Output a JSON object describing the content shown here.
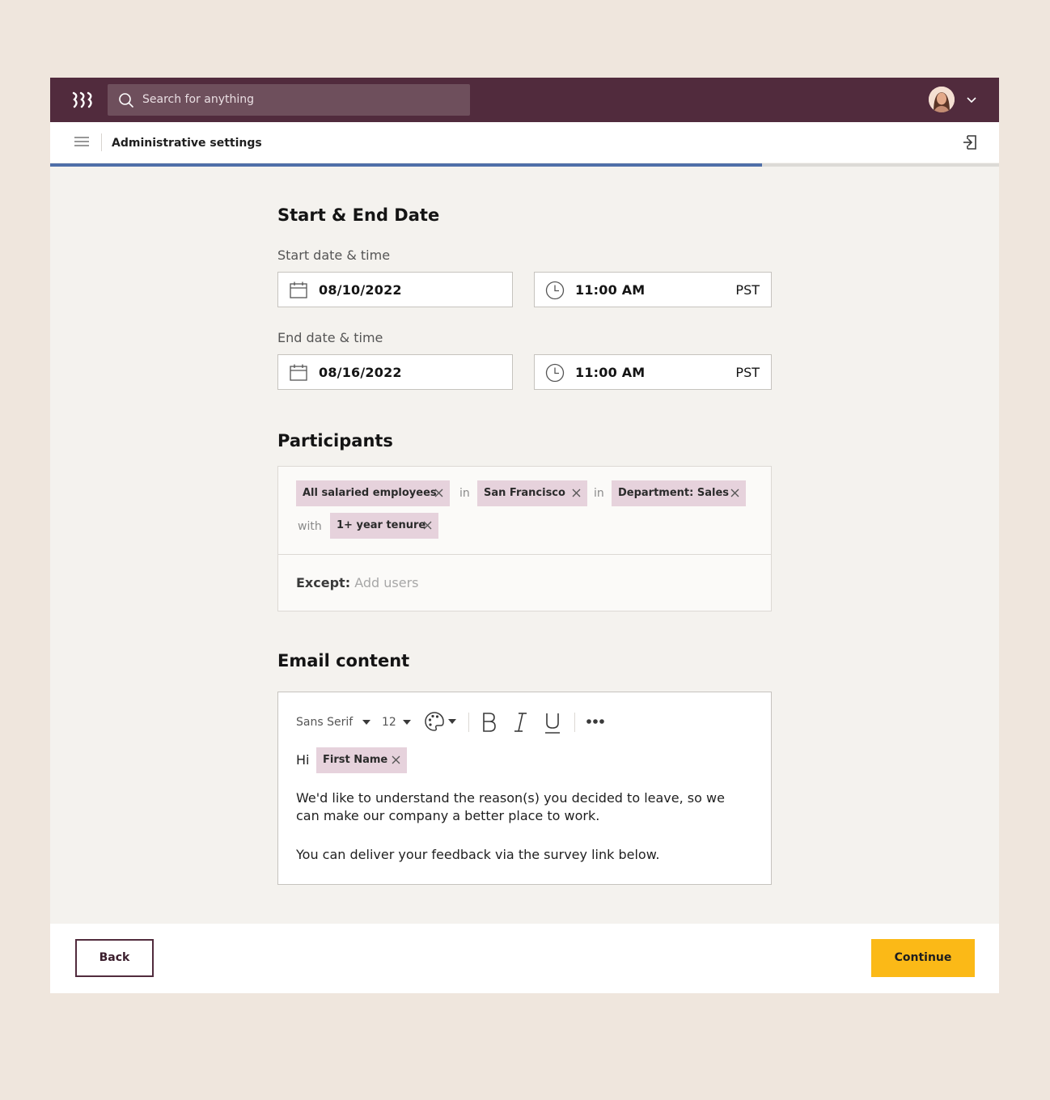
{
  "search": {
    "placeholder": "Search for anything"
  },
  "subheader": {
    "title": "Administrative settings"
  },
  "progress": {
    "fraction": 0.75
  },
  "dates": {
    "section_title": "Start & End Date",
    "start_label": "Start date & time",
    "start_date": "08/10/2022",
    "start_time": "11:00 AM",
    "start_tz": "PST",
    "end_label": "End date & time",
    "end_date": "08/16/2022",
    "end_time": "11:00 AM",
    "end_tz": "PST"
  },
  "participants": {
    "section_title": "Participants",
    "chips": [
      "All salaried employees",
      "San Francisco",
      "Department: Sales",
      "1+ year tenure"
    ],
    "connectors": [
      "in",
      "in",
      "with"
    ],
    "except_label": "Except:",
    "except_placeholder": "Add users"
  },
  "email": {
    "section_title": "Email content",
    "font": "Sans Serif",
    "size": "12",
    "greeting": "Hi",
    "name_chip": "First Name",
    "para1_line1": "We'd like to understand the reason(s) you decided to leave, so we",
    "para1_line2": "can make our company a better place to work.",
    "para2": "You can deliver your feedback via the survey link below."
  },
  "footer": {
    "back_label": "Back",
    "continue_label": "Continue"
  },
  "colors": {
    "topbar": "#512b3d",
    "accent": "#fbb917",
    "progress": "#4f6fa8",
    "chip": "#e6d2dc"
  },
  "icons": [
    "logo-icon",
    "search-icon",
    "chevron-down-icon",
    "menu-icon",
    "exit-icon",
    "calendar-icon",
    "clock-icon",
    "close-icon",
    "palette-icon",
    "bold-icon",
    "italic-icon",
    "underline-icon",
    "more-icon"
  ]
}
